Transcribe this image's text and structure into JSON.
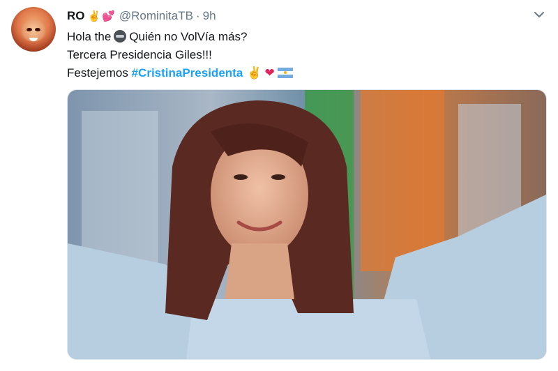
{
  "tweet": {
    "author_name": "RO",
    "author_emoji": [
      "✌",
      "💕"
    ],
    "handle": "@RominitaTB",
    "separator": "·",
    "time": "9h",
    "lines": {
      "line1_a": "Hola the",
      "line1_b": "Quién no VolVía más?",
      "line2": "Tercera Presidencia Giles!!!",
      "line3_prefix": "Festejemos ",
      "hashtag": "#CristinaPresidenta"
    },
    "trailing_emoji": [
      "✌",
      "❤",
      "flag-argentina"
    ]
  },
  "icons": {
    "avatar": "avatar-image",
    "menu": "chevron-down-icon",
    "ninja": "ninja-emoji-icon"
  },
  "colors": {
    "link": "#1da1f2",
    "secondary_text": "#657786",
    "heart": "#e0245e"
  }
}
